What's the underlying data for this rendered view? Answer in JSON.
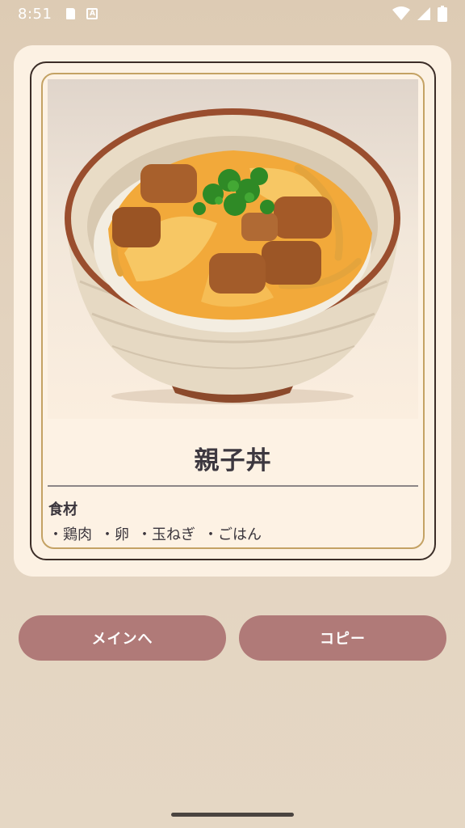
{
  "status_bar": {
    "time": "8:51",
    "icons": [
      "sd-card-icon",
      "a-icon",
      "wifi-icon",
      "signal-icon",
      "battery-icon"
    ]
  },
  "recipe": {
    "title": "親子丼",
    "ingredients_heading": "食材",
    "ingredients": [
      "・鶏肉",
      "・卵",
      "・玉ねぎ",
      "・ごはん"
    ]
  },
  "buttons": {
    "main_label": "メインへ",
    "copy_label": "コピー"
  },
  "colors": {
    "button": "#b07a78",
    "frame_gold": "#c4a264",
    "frame_dark": "#3b2d27",
    "card_bg": "#fcf1e3"
  }
}
